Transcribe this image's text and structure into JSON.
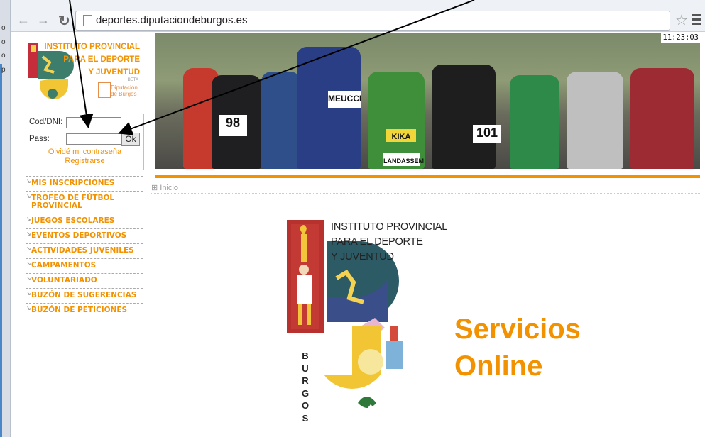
{
  "browser": {
    "url": "deportes.diputaciondeburgos.es",
    "left_strip_chars": [
      "o",
      "o",
      "o",
      "p"
    ]
  },
  "logo": {
    "line1": "INSTITUTO PROVINCIAL",
    "line2": "PARA EL DEPORTE",
    "line3": "Y JUVENTUD",
    "beta": "BETA",
    "diputacion": "Diputación",
    "de_burgos": "de Burgos"
  },
  "login": {
    "cod_label": "Cod/DNI:",
    "pass_label": "Pass:",
    "ok_label": "Ok",
    "forgot": "Olvidé mi contraseña",
    "register": "Registrarse"
  },
  "menu": {
    "items": [
      "MIS INSCRIPCIONES",
      "TROFEO DE FÚTBOL PROVINCIAL",
      "JUEGOS ESCOLARES",
      "EVENTOS DEPORTIVOS",
      "ACTIVIDADES JUVENILES",
      "CAMPAMENTOS",
      "VOLUNTARIADO",
      "BUZÓN DE SUGERENCIAS",
      "BUZÓN DE PETICIONES"
    ]
  },
  "banner": {
    "clock": "11:23:03",
    "bibs": [
      "98",
      "101",
      "MEUCCI",
      "KIKA",
      "LANDASSEM"
    ]
  },
  "breadcrumb": "Inicio",
  "main": {
    "title_line1": "INSTITUTO PROVINCIAL",
    "title_line2": "PARA EL DEPORTE",
    "title_line3": "Y JUVENTUD",
    "servicios": "Servicios",
    "online": "Online",
    "burgos_letters": [
      "B",
      "U",
      "R",
      "G",
      "O",
      "S"
    ]
  },
  "colors": {
    "accent": "#f39200",
    "text": "#222222"
  }
}
